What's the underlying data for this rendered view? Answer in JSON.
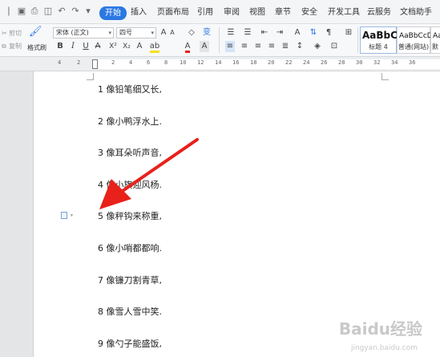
{
  "menu": {
    "tabs": [
      {
        "label": "开始",
        "active": true
      },
      {
        "label": "插入"
      },
      {
        "label": "页面布局"
      },
      {
        "label": "引用"
      },
      {
        "label": "审阅"
      },
      {
        "label": "视图"
      },
      {
        "label": "章节"
      },
      {
        "label": "安全"
      },
      {
        "label": "开发工具"
      },
      {
        "label": "云服务"
      },
      {
        "label": "文档助手"
      }
    ]
  },
  "ribbon": {
    "clipboard": {
      "cut_label": "剪切",
      "copy_label": "复制",
      "format_painter_label": "格式刷"
    },
    "font": {
      "family_value": "宋体 (正文)",
      "size_value": "四号"
    },
    "styles": [
      {
        "preview": "AaBbC",
        "name": "标题 4"
      },
      {
        "preview": "AaBbCcD",
        "name": "普通(网站)"
      },
      {
        "preview": "Aa",
        "name": "默"
      }
    ]
  },
  "ruler": {
    "numbers": [
      "4",
      "2",
      "2",
      "4",
      "6",
      "8",
      "10",
      "12",
      "14",
      "16",
      "18",
      "20",
      "22",
      "24",
      "26",
      "28",
      "30",
      "32",
      "34",
      "36"
    ]
  },
  "document": {
    "lines": [
      "1 像铅笔细又长,",
      "2 像小鸭浮水上.",
      "3 像耳朵听声音,",
      "4 像小旗迎风杨.",
      "5 像秤钩来称重,",
      "6 像小哨都都响.",
      "7 像镰刀割青草,",
      "8 像雪人雪中笑.",
      "9 像勺子能盛饭,"
    ]
  },
  "watermark": {
    "text": "Baidu经验",
    "url": "jingyan.baidu.com"
  },
  "colors": {
    "accent": "#2b78e4",
    "arrow": "#e8211b"
  }
}
